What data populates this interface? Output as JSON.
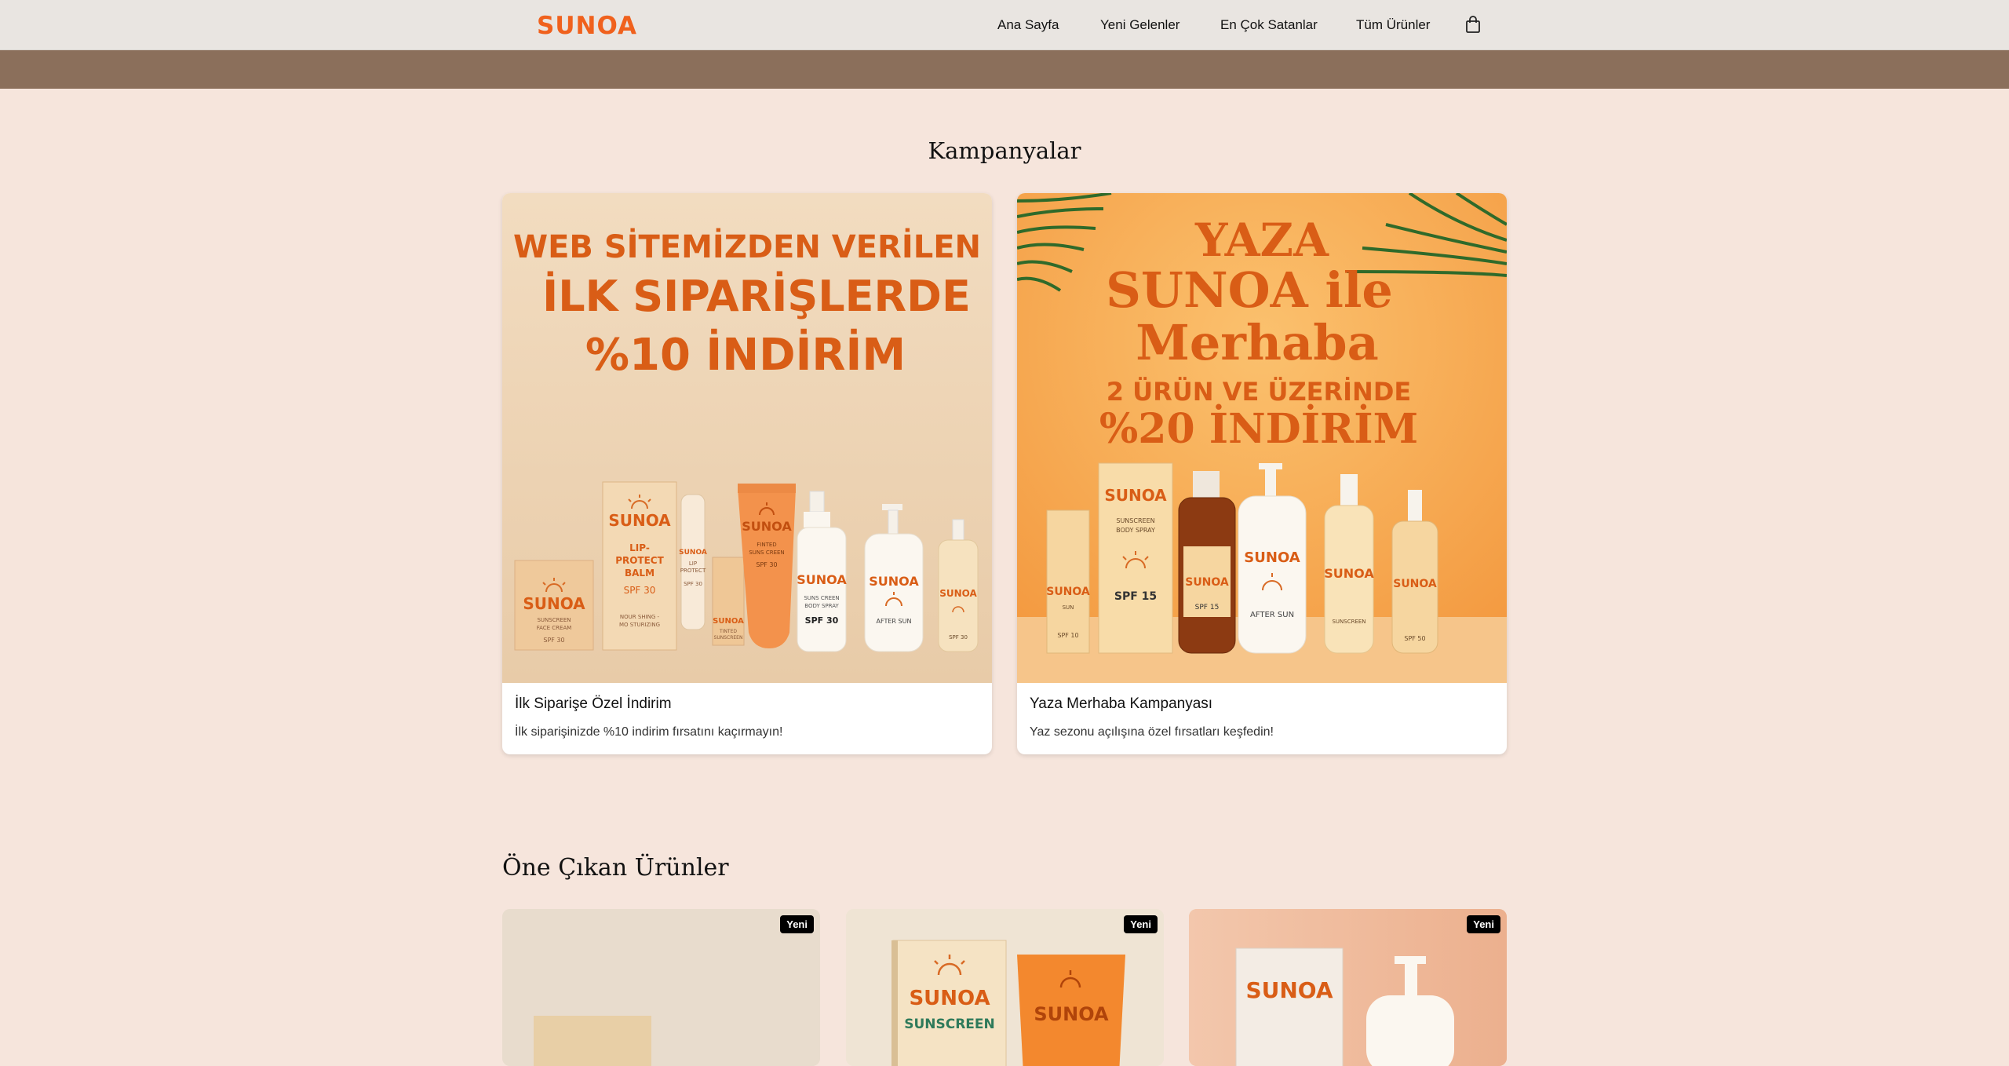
{
  "header": {
    "logo": "SUNOA",
    "nav": [
      "Ana Sayfa",
      "Yeni Gelenler",
      "En Çok Satanlar",
      "Tüm Ürünler"
    ]
  },
  "campaigns": {
    "title": "Kampanyalar",
    "items": [
      {
        "title": "İlk Siparişe Özel İndirim",
        "description": "İlk siparişinizde %10 indirim fırsatını kaçırmayın!",
        "banner_lines": [
          "WEB SİTEMİZDEN VERİLEN",
          "İLK SIPARİŞLERDE",
          "%10 İNDİRİM"
        ],
        "product_texts": {
          "box": [
            "SUNOA",
            "SUNSCREEN",
            "FACE CREAM",
            "SPF 30"
          ],
          "tall_box": [
            "SUNOA",
            "LIP-",
            "PROTECT",
            "BALM",
            "SPF 30",
            "NOUR SHING -",
            "MO STURIZING"
          ],
          "lip": [
            "SUNOA",
            "LIP",
            "PROTECT",
            "SPF 30"
          ],
          "small_box": [
            "SUNOA",
            "TINTED",
            "SUNSCREEN"
          ],
          "tube": [
            "SUNOA",
            "FINTED",
            "SUNS CREEN",
            "SPF 30"
          ],
          "spray": [
            "SUNOA",
            "SUNS CREEN",
            "BODY SPRAY",
            "SPF 30"
          ],
          "pump": [
            "SUNOA",
            "AFTER SUN"
          ],
          "serum": [
            "SUNOA",
            "SPF 30"
          ]
        }
      },
      {
        "title": "Yaza Merhaba Kampanyası",
        "description": "Yaz sezonu açılışına özel fırsatları keşfedin!",
        "banner_lines": [
          "YAZA",
          "SUNOA ile",
          "Merhaba",
          "2 ÜRÜN VE ÜZERİNDE",
          "%20 İNDİRİM"
        ],
        "product_texts": {
          "stick": [
            "SUNOA",
            "SUN",
            "SPF 10"
          ],
          "box": [
            "SUNOA",
            "SUNSCREEN",
            "BODY SPRAY",
            "SPF 15"
          ],
          "amber": [
            "SUNOA",
            "SPF 15"
          ],
          "pump": [
            "SUNOA",
            "AFTER SUN"
          ],
          "spray": [
            "SUNOA",
            "SUNSCREEN"
          ],
          "small": [
            "SUNOA",
            "SPF 50"
          ]
        }
      }
    ]
  },
  "featured": {
    "title": "Öne Çıkan Ürünler",
    "products": [
      {
        "badge": "Yeni",
        "texts": []
      },
      {
        "badge": "Yeni",
        "texts": [
          "SUNOA",
          "SUNSCREEN",
          "SUNOA"
        ]
      },
      {
        "badge": "Yeni",
        "texts": [
          "SUNOA"
        ]
      }
    ]
  }
}
